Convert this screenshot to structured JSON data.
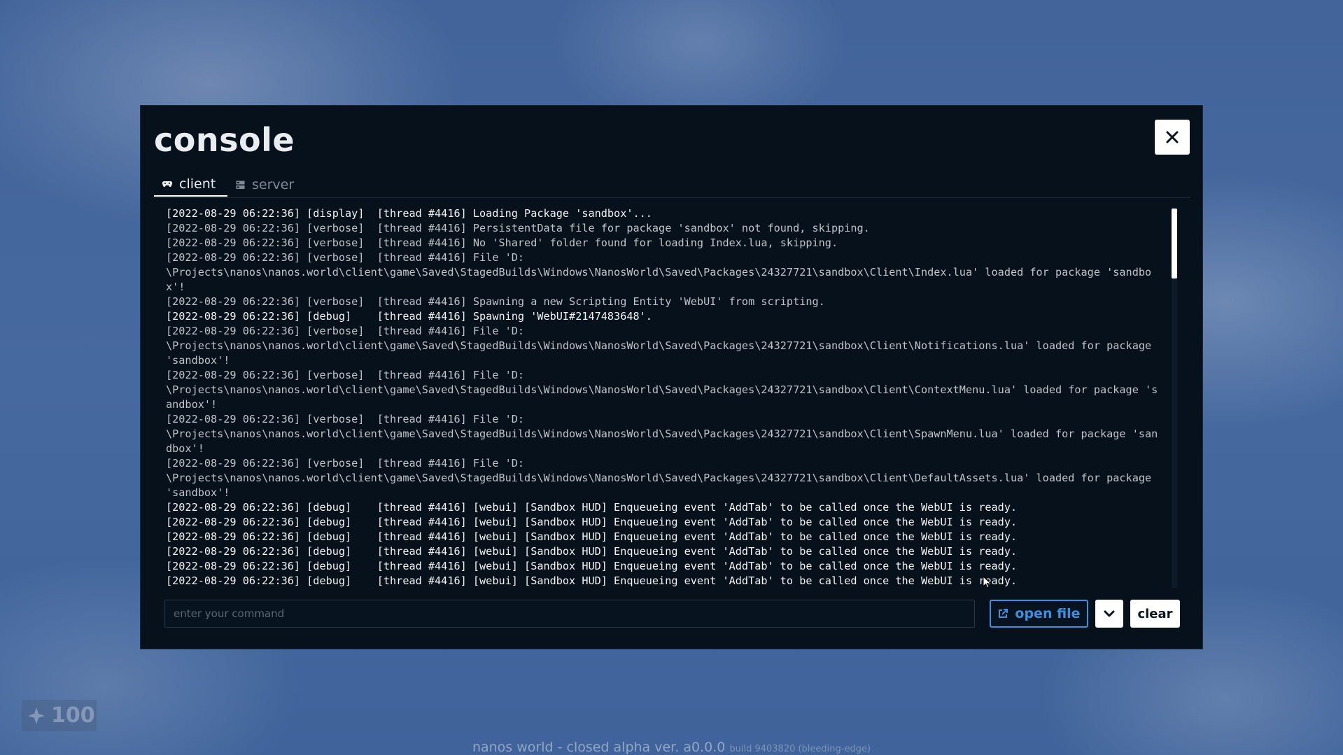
{
  "console": {
    "title": "console",
    "close_icon": "close-icon"
  },
  "tabs": [
    {
      "label": "client",
      "icon": "gamepad-icon",
      "active": true
    },
    {
      "label": "server",
      "icon": "server-icon",
      "active": false
    }
  ],
  "log_lines": [
    {
      "text": "[2022-08-29 06:22:36] [display]  [thread #4416] Loading Package 'sandbox'...",
      "level": "display"
    },
    {
      "text": "[2022-08-29 06:22:36] [verbose]  [thread #4416] PersistentData file for package 'sandbox' not found, skipping.",
      "level": "verbose"
    },
    {
      "text": "[2022-08-29 06:22:36] [verbose]  [thread #4416] No 'Shared' folder found for loading Index.lua, skipping.",
      "level": "verbose"
    },
    {
      "text": "[2022-08-29 06:22:36] [verbose]  [thread #4416] File 'D:\n\\Projects\\nanos\\nanos.world\\client\\game\\Saved\\StagedBuilds\\Windows\\NanosWorld\\Saved\\Packages\\24327721\\sandbox\\Client\\Index.lua' loaded for package 'sandbox'!",
      "level": "verbose"
    },
    {
      "text": "[2022-08-29 06:22:36] [verbose]  [thread #4416] Spawning a new Scripting Entity 'WebUI' from scripting.",
      "level": "verbose"
    },
    {
      "text": "[2022-08-29 06:22:36] [debug]    [thread #4416] Spawning 'WebUI#2147483648'.",
      "level": "debug"
    },
    {
      "text": "[2022-08-29 06:22:36] [verbose]  [thread #4416] File 'D:\n\\Projects\\nanos\\nanos.world\\client\\game\\Saved\\StagedBuilds\\Windows\\NanosWorld\\Saved\\Packages\\24327721\\sandbox\\Client\\Notifications.lua' loaded for package 'sandbox'!",
      "level": "verbose"
    },
    {
      "text": "[2022-08-29 06:22:36] [verbose]  [thread #4416] File 'D:\n\\Projects\\nanos\\nanos.world\\client\\game\\Saved\\StagedBuilds\\Windows\\NanosWorld\\Saved\\Packages\\24327721\\sandbox\\Client\\ContextMenu.lua' loaded for package 'sandbox'!",
      "level": "verbose"
    },
    {
      "text": "[2022-08-29 06:22:36] [verbose]  [thread #4416] File 'D:\n\\Projects\\nanos\\nanos.world\\client\\game\\Saved\\StagedBuilds\\Windows\\NanosWorld\\Saved\\Packages\\24327721\\sandbox\\Client\\SpawnMenu.lua' loaded for package 'sandbox'!",
      "level": "verbose"
    },
    {
      "text": "[2022-08-29 06:22:36] [verbose]  [thread #4416] File 'D:\n\\Projects\\nanos\\nanos.world\\client\\game\\Saved\\StagedBuilds\\Windows\\NanosWorld\\Saved\\Packages\\24327721\\sandbox\\Client\\DefaultAssets.lua' loaded for package 'sandbox'!",
      "level": "verbose"
    },
    {
      "text": "[2022-08-29 06:22:36] [debug]    [thread #4416] [webui] [Sandbox HUD] Enqueueing event 'AddTab' to be called once the WebUI is ready.",
      "level": "debug"
    },
    {
      "text": "[2022-08-29 06:22:36] [debug]    [thread #4416] [webui] [Sandbox HUD] Enqueueing event 'AddTab' to be called once the WebUI is ready.",
      "level": "debug"
    },
    {
      "text": "[2022-08-29 06:22:36] [debug]    [thread #4416] [webui] [Sandbox HUD] Enqueueing event 'AddTab' to be called once the WebUI is ready.",
      "level": "debug"
    },
    {
      "text": "[2022-08-29 06:22:36] [debug]    [thread #4416] [webui] [Sandbox HUD] Enqueueing event 'AddTab' to be called once the WebUI is ready.",
      "level": "debug"
    },
    {
      "text": "[2022-08-29 06:22:36] [debug]    [thread #4416] [webui] [Sandbox HUD] Enqueueing event 'AddTab' to be called once the WebUI is ready.",
      "level": "debug"
    },
    {
      "text": "[2022-08-29 06:22:36] [debug]    [thread #4416] [webui] [Sandbox HUD] Enqueueing event 'AddTab' to be called once the WebUI is ready.",
      "level": "debug"
    }
  ],
  "command_bar": {
    "input_value": "",
    "placeholder": "enter your command",
    "open_file_label": "open file",
    "open_file_icon": "external-link-icon",
    "dropdown_icon": "chevron-down-icon",
    "clear_label": "clear"
  },
  "hud": {
    "health_value": "100",
    "health_icon": "health-icon"
  },
  "footer": {
    "version_text": "nanos world - closed alpha  ver. a0.0.0",
    "build_text": "build 9403820  (bleeding-edge)"
  },
  "colors": {
    "console_bg": "#06111c",
    "accent": "#3d8fe0",
    "background": "#42649a"
  }
}
